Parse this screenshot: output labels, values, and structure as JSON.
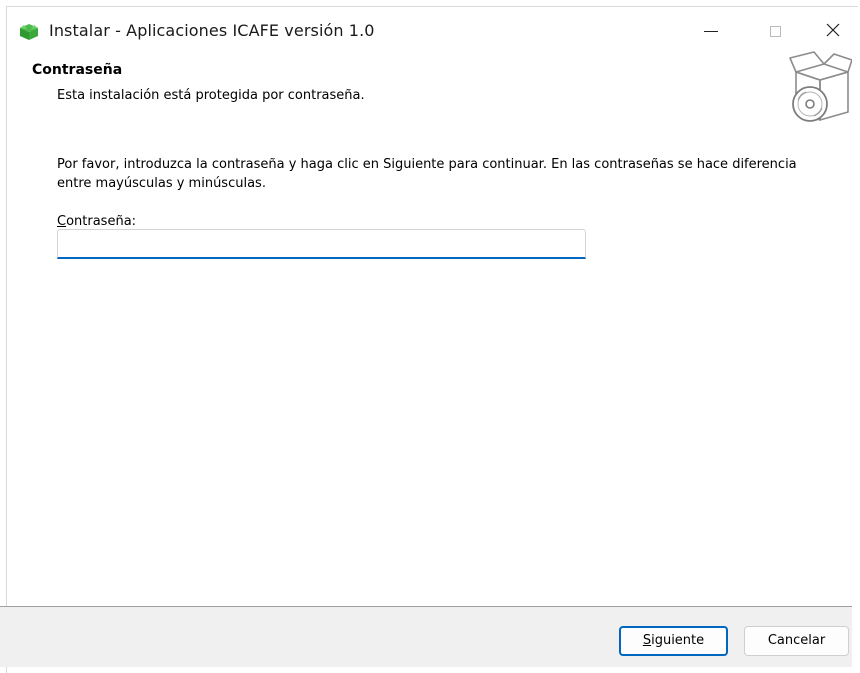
{
  "window": {
    "title": "Instalar - Aplicaciones ICAFE versión 1.0"
  },
  "header": {
    "heading": "Contraseña",
    "subheading": "Esta instalación está protegida por contraseña."
  },
  "content": {
    "instructions": "Por favor, introduzca la contraseña y haga clic en Siguiente para continuar. En las contraseñas se hace diferencia entre mayúsculas y minúsculas.",
    "password_label_first": "C",
    "password_label_rest": "ontraseña:",
    "password_value": "",
    "password_placeholder": ""
  },
  "footer": {
    "next_first": "S",
    "next_rest": "iguiente",
    "cancel_label": "Cancelar"
  },
  "icons": {
    "app": "setup-app-icon",
    "setup_box": "setup-box-disc-icon"
  },
  "colors": {
    "accent": "#0067c0",
    "footer_bg": "#f0f0f0",
    "app_icon": "#3aa83a"
  }
}
